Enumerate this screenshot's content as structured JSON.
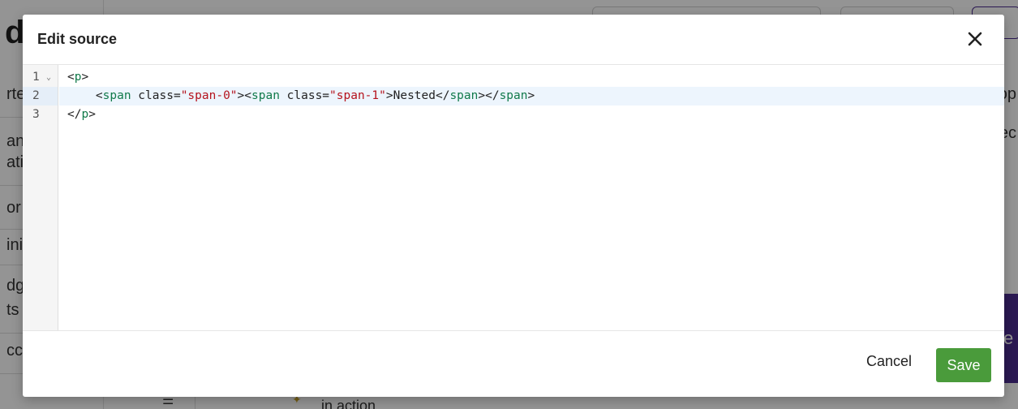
{
  "background": {
    "heading_fragment": "d",
    "left_fragments": [
      "rte",
      "an",
      "ati",
      "or",
      "ini",
      "dg",
      "ts",
      "cc"
    ],
    "right_fragments": [
      "op",
      "ec"
    ],
    "purple_fragment": "e",
    "bottom_text": "in action",
    "colors": {
      "purple": "#4b2b8f"
    }
  },
  "modal": {
    "title": "Edit source",
    "close_icon": "close-icon",
    "editor": {
      "active_line": 2,
      "line_numbers": [
        "1",
        "2",
        "3"
      ],
      "fold_marker": "⌄",
      "lines": [
        [
          {
            "type": "pun",
            "text": "<"
          },
          {
            "type": "tag",
            "text": "p"
          },
          {
            "type": "pun",
            "text": ">"
          }
        ],
        [
          {
            "type": "pun",
            "text": "    <"
          },
          {
            "type": "tag",
            "text": "span"
          },
          {
            "type": "attr",
            "text": " class="
          },
          {
            "type": "str",
            "text": "\"span-0\""
          },
          {
            "type": "pun",
            "text": "><"
          },
          {
            "type": "tag",
            "text": "span"
          },
          {
            "type": "attr",
            "text": " class="
          },
          {
            "type": "str",
            "text": "\"span-1\""
          },
          {
            "type": "pun",
            "text": ">Nested</"
          },
          {
            "type": "tag",
            "text": "span"
          },
          {
            "type": "pun",
            "text": "></"
          },
          {
            "type": "tag",
            "text": "span"
          },
          {
            "type": "pun",
            "text": ">"
          }
        ],
        [
          {
            "type": "pun",
            "text": "</"
          },
          {
            "type": "tag",
            "text": "p"
          },
          {
            "type": "pun",
            "text": ">"
          }
        ]
      ]
    },
    "footer": {
      "cancel_label": "Cancel",
      "save_label": "Save"
    },
    "colors": {
      "save": "#4a9b3b",
      "tag": "#117a4a",
      "string": "#b5141e"
    }
  }
}
